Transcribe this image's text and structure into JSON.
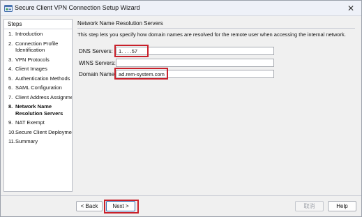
{
  "window": {
    "title": "Secure Client VPN Connection Setup Wizard",
    "close_glyph": "✕"
  },
  "steps": {
    "header": "Steps",
    "items": [
      {
        "num": "1.",
        "label": "Introduction",
        "active": false
      },
      {
        "num": "2.",
        "label": "Connection Profile Identification",
        "active": false
      },
      {
        "num": "3.",
        "label": "VPN Protocols",
        "active": false
      },
      {
        "num": "4.",
        "label": "Client Images",
        "active": false
      },
      {
        "num": "5.",
        "label": "Authentication Methods",
        "active": false
      },
      {
        "num": "6.",
        "label": "SAML Configuration",
        "active": false
      },
      {
        "num": "7.",
        "label": "Client Address Assignme",
        "active": false
      },
      {
        "num": "8.",
        "label": "Network Name Resolution Servers",
        "active": true
      },
      {
        "num": "9.",
        "label": "NAT Exempt",
        "active": false
      },
      {
        "num": "10.",
        "label": "Secure Client Deployme",
        "active": false
      },
      {
        "num": "11.",
        "label": "Summary",
        "active": false
      }
    ]
  },
  "content": {
    "section_title": "Network Name Resolution Servers",
    "description": "This step lets you specify how domain names are resolved for the remote user when accessing the internal network.",
    "fields": {
      "dns": {
        "label": "DNS Servers:",
        "value": "1. . . .57"
      },
      "wins": {
        "label": "WINS Servers:",
        "value": ""
      },
      "domain": {
        "label": "Domain Name:",
        "value": "ad.rem-system.com"
      }
    }
  },
  "buttons": {
    "back": "< Back",
    "next": "Next >",
    "cancel": "取消",
    "help": "Help"
  },
  "colors": {
    "highlight": "#c8202a",
    "accent": "#3b6fb3"
  },
  "icons": {
    "app": "vpn-wizard-icon",
    "close": "close-icon"
  }
}
